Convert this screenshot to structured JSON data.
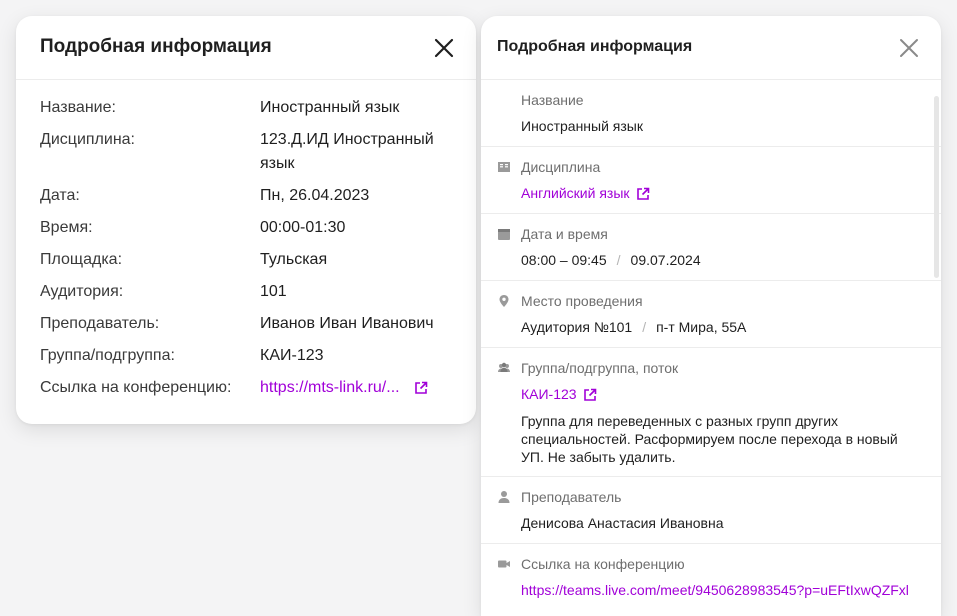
{
  "left_panel": {
    "title": "Подробная информация",
    "rows": [
      {
        "key": "Название:",
        "value": "Иностранный язык"
      },
      {
        "key": "Дисциплина:",
        "value": "123.Д.ИД Иностранный язык"
      },
      {
        "key": "Дата:",
        "value": "Пн, 26.04.2023"
      },
      {
        "key": "Время:",
        "value": "00:00-01:30"
      },
      {
        "key": "Площадка:",
        "value": "Тульская"
      },
      {
        "key": "Аудитория:",
        "value": "101"
      },
      {
        "key": "Преподаватель:",
        "value": "Иванов Иван Иванович"
      },
      {
        "key": "Группа/подгруппа:",
        "value": "КАИ-123"
      },
      {
        "key": "Ссылка на конференцию:",
        "value": "https://mts-link.ru/..."
      }
    ]
  },
  "right_panel": {
    "title": "Подробная информация",
    "name": {
      "label": "Название",
      "value": "Иностранный язык"
    },
    "discipline": {
      "label": "Дисциплина",
      "value": "Английский язык"
    },
    "datetime": {
      "label": "Дата и время",
      "time": "08:00 – 09:45",
      "separator": "/",
      "date": "09.07.2024"
    },
    "place": {
      "label": "Место проведения",
      "room": "Аудитория №101",
      "separator": "/",
      "address": "п-т Мира, 55А"
    },
    "group": {
      "label": "Группа/подгруппа, поток",
      "value": "КАИ-123",
      "note": "Группа для переведенных с разных групп других специальностей. Расформируем после перехода в новый УП. Не забыть удалить."
    },
    "teacher": {
      "label": "Преподаватель",
      "value": "Денисова Анастасия Ивановна"
    },
    "conference": {
      "label": "Ссылка на конференцию",
      "value": "https://teams.live.com/meet/9450628983545?p=uEFtIxwQZFxl"
    }
  },
  "colors": {
    "accent": "#a100d8",
    "background": "#f4f4f5",
    "card": "#ffffff"
  }
}
